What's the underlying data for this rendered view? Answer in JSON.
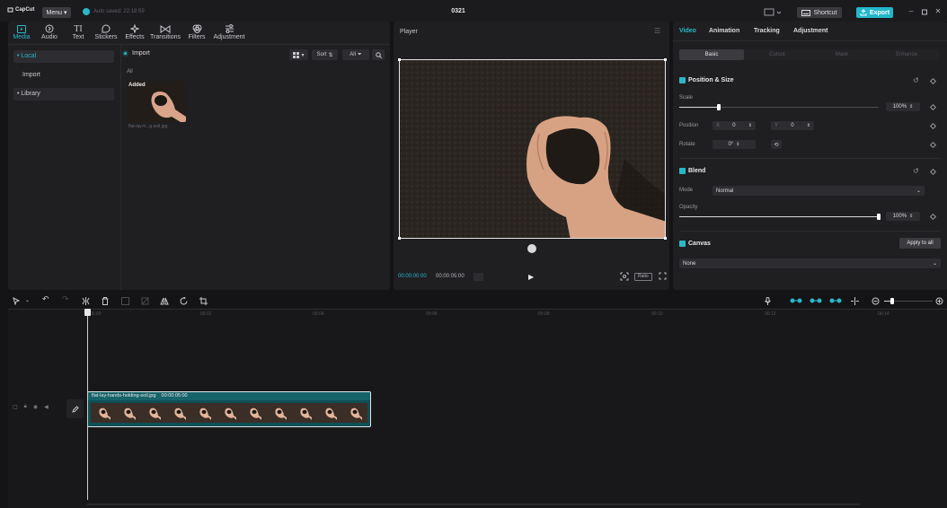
{
  "app": {
    "logo_text": "CapCut",
    "menu_label": "Menu",
    "autosave_text": "Auto saved: 22:18:59",
    "project_title": "0321",
    "shortcut_label": "Shortcut",
    "export_label": "Export"
  },
  "media": {
    "tabs": [
      {
        "label": "Media",
        "icon": "media-icon",
        "active": true
      },
      {
        "label": "Audio",
        "icon": "audio-icon"
      },
      {
        "label": "Text",
        "icon": "text-icon"
      },
      {
        "label": "Stickers",
        "icon": "sticker-icon"
      },
      {
        "label": "Effects",
        "icon": "effects-icon"
      },
      {
        "label": "Transitions",
        "icon": "transitions-icon"
      },
      {
        "label": "Filters",
        "icon": "filters-icon"
      },
      {
        "label": "Adjustment",
        "icon": "adjustment-icon"
      }
    ],
    "sidebar": [
      {
        "label": "• Local",
        "active": true
      },
      {
        "label": "Import"
      },
      {
        "label": "• Library"
      }
    ],
    "import_label": "Import",
    "sort_label": "Sort",
    "all_filter_label": "All",
    "all_label": "All",
    "added_badge": "Added",
    "thumb_name": "flat-lay-h...g-soil.jpg"
  },
  "player": {
    "title": "Player",
    "time_current": "00:00:00:00",
    "time_total": "00:00:05:00",
    "ratio_label": "Ratio"
  },
  "properties": {
    "tabs": [
      {
        "label": "Video",
        "active": true
      },
      {
        "label": "Animation"
      },
      {
        "label": "Tracking"
      },
      {
        "label": "Adjustment"
      }
    ],
    "subtabs": [
      {
        "label": "Basic",
        "active": true
      },
      {
        "label": "Cutout"
      },
      {
        "label": "Mask"
      },
      {
        "label": "Enhance"
      }
    ],
    "position_size": {
      "title": "Position & Size",
      "scale_label": "Scale",
      "scale_value": "100%",
      "scale_fraction": 0.2,
      "position_label": "Position",
      "x_label": "X",
      "x_value": "0",
      "y_label": "Y",
      "y_value": "0",
      "rotate_label": "Rotate",
      "rotate_value": "0°"
    },
    "blend": {
      "title": "Blend",
      "mode_label": "Mode",
      "mode_value": "Normal",
      "opacity_label": "Opacity",
      "opacity_value": "100%",
      "opacity_fraction": 1.0
    },
    "canvas": {
      "title": "Canvas",
      "apply_all_label": "Apply to all",
      "value": "None"
    }
  },
  "timeline": {
    "ticks": [
      "00:00",
      "00:02",
      "00:04",
      "00:06",
      "00:08",
      "00:10",
      "00:12",
      "00:14"
    ],
    "clip_name": "flat-lay-hands-holding-soil.jpg",
    "clip_duration": "00:00:05:00",
    "frame_count": 11
  }
}
